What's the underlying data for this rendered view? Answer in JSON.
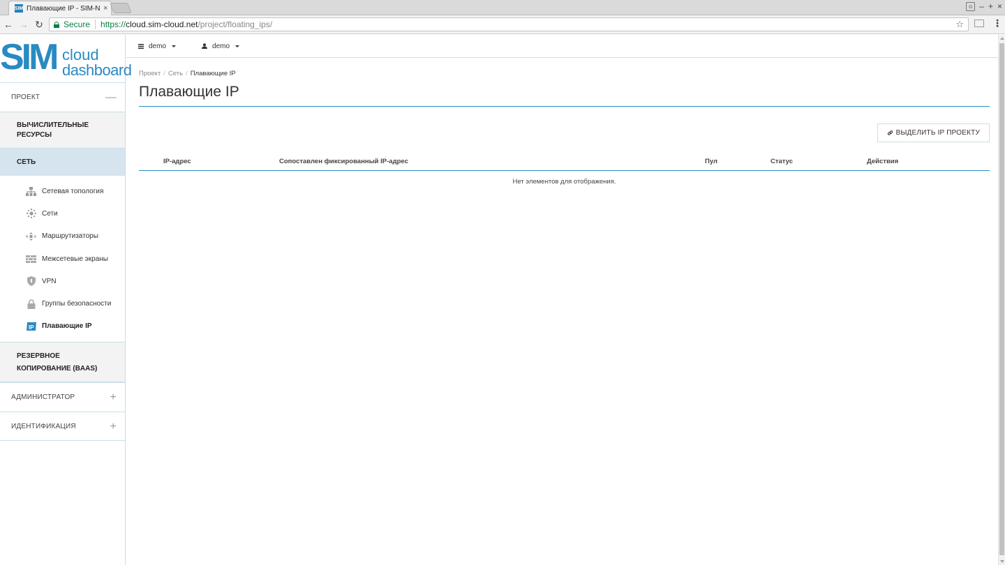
{
  "browser": {
    "tab_title": "Плавающие IP - SIM-N",
    "tab_close": "×",
    "favicon_text": "SIM",
    "secure_label": "Secure",
    "url_scheme": "https://",
    "url_host": "cloud.sim-cloud.net",
    "url_path": "/project/floating_ips/",
    "window_controls": [
      "–",
      "+",
      "×"
    ]
  },
  "logo": {
    "sim": "SIM",
    "line1": "cloud",
    "line2": "dashboard"
  },
  "sidebar": {
    "project_header": "ПРОЕКТ",
    "project_toggle": "—",
    "compute_group": "ВЫЧИСЛИТЕЛЬНЫЕ РЕСУРСЫ",
    "network_group": "СЕТЬ",
    "network_items": [
      {
        "label": "Сетевая топология",
        "icon": "topology-icon"
      },
      {
        "label": "Сети",
        "icon": "networks-icon"
      },
      {
        "label": "Маршрутизаторы",
        "icon": "routers-icon"
      },
      {
        "label": "Межсетевые экраны",
        "icon": "firewall-icon"
      },
      {
        "label": "VPN",
        "icon": "shield-icon"
      },
      {
        "label": "Группы безопасности",
        "icon": "lock-icon"
      },
      {
        "label": "Плавающие IP",
        "icon": "floating-ip-icon"
      }
    ],
    "backup_group": "РЕЗЕРВНОЕ КОПИРОВАНИЕ (BAAS)",
    "admin_header": "АДМИНИСТРАТОР",
    "identity_header": "ИДЕНТИФИКАЦИЯ",
    "expand_toggle": "+"
  },
  "topnav": {
    "project": "demo",
    "user": "demo"
  },
  "breadcrumb": {
    "items": [
      "Проект",
      "Сеть"
    ],
    "current": "Плавающие IP",
    "separator": "/"
  },
  "page": {
    "title": "Плавающие IP",
    "allocate_button": "ВЫДЕЛИТЬ IP ПРОЕКТУ"
  },
  "table": {
    "columns": [
      "IP-адрес",
      "Сопоставлен фиксированный IP-адрес",
      "Пул",
      "Статус",
      "Действия"
    ],
    "empty_message": "Нет элементов для отображения."
  },
  "colors": {
    "brand": "#2a8ac2",
    "active_group": "#d5e4ef",
    "secure_green": "#0b8043"
  }
}
